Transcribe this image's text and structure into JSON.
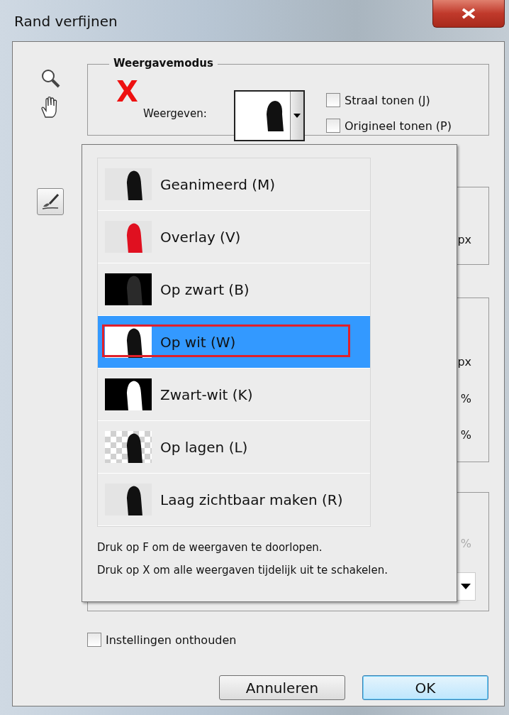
{
  "window": {
    "title": "Rand verfijnen"
  },
  "view_mode": {
    "legend": "Weergavemodus",
    "marker": "X",
    "label": "Weergeven:",
    "current": {
      "kind": "white"
    },
    "checkboxes": [
      {
        "label": "Straal tonen (J)",
        "checked": false
      },
      {
        "label": "Origineel tonen (P)",
        "checked": false
      }
    ]
  },
  "background_groups": [
    {
      "kind": "plain",
      "texts": [
        {
          "text": "px",
          "disabled": false
        }
      ]
    },
    {
      "kind": "plain",
      "texts": [
        {
          "text": "px",
          "disabled": false
        },
        {
          "text": "%",
          "disabled": false
        },
        {
          "text": "%",
          "disabled": false
        }
      ]
    },
    {
      "kind": "with_dropdown",
      "texts": [
        {
          "text": "%",
          "disabled": true
        }
      ]
    }
  ],
  "menu": {
    "items": [
      {
        "label": "Geanimeerd (M)",
        "kind": "light",
        "selected": false,
        "outlined": false
      },
      {
        "label": "Overlay (V)",
        "kind": "overlay",
        "selected": false,
        "outlined": false
      },
      {
        "label": "Op zwart (B)",
        "kind": "black",
        "selected": false,
        "outlined": false
      },
      {
        "label": "Op wit (W)",
        "kind": "white",
        "selected": true,
        "outlined": true
      },
      {
        "label": "Zwart-wit (K)",
        "kind": "mask",
        "selected": false,
        "outlined": false
      },
      {
        "label": "Op lagen (L)",
        "kind": "checker",
        "selected": false,
        "outlined": false
      },
      {
        "label": "Laag zichtbaar maken (R)",
        "kind": "light",
        "selected": false,
        "outlined": false
      }
    ],
    "hints": [
      "Druk op F om de weergaven te doorlopen.",
      "Druk op X om alle weergaven tijdelijk uit te schakelen."
    ]
  },
  "remember": {
    "label": "Instellingen onthouden",
    "checked": false
  },
  "buttons": [
    {
      "label": "Annuleren",
      "default": false
    },
    {
      "label": "OK",
      "default": true
    }
  ]
}
